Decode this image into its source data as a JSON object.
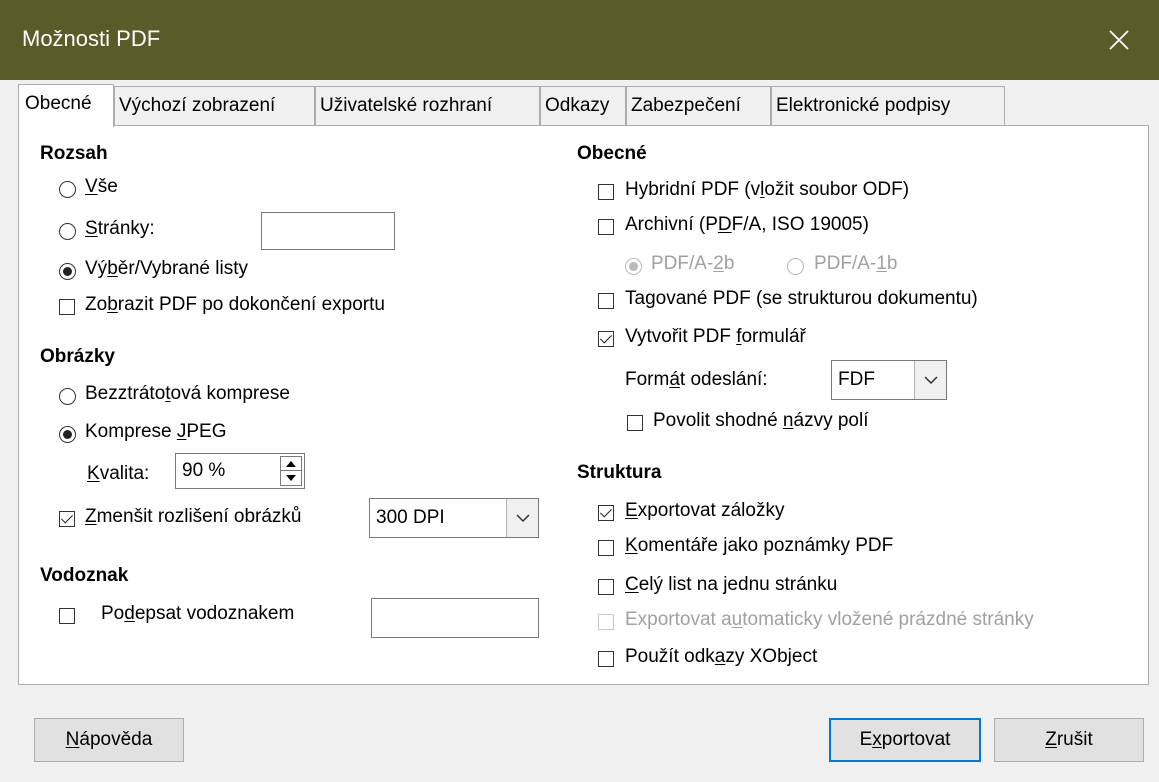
{
  "window": {
    "title": "Možnosti PDF",
    "close_icon": "close-icon"
  },
  "tabs": [
    {
      "label": "Obecné",
      "active": true
    },
    {
      "label": "Výchozí zobrazení"
    },
    {
      "label": "Uživatelské rozhraní"
    },
    {
      "label": "Odkazy"
    },
    {
      "label": "Zabezpečení"
    },
    {
      "label": "Elektronické podpisy"
    }
  ],
  "range": {
    "heading": "Rozsah",
    "all": {
      "pre": "",
      "mn": "V",
      "post": "še",
      "checked": false
    },
    "pages": {
      "pre": "",
      "mn": "S",
      "post": "tránky:",
      "checked": false,
      "value": ""
    },
    "selection": {
      "pre": "Vý",
      "mn": "b",
      "post": "ěr/Vybrané listy",
      "checked": true
    },
    "view_pdf": {
      "pre": "Zo",
      "mn": "b",
      "post": "razit PDF po dokončení exportu",
      "checked": false
    }
  },
  "images": {
    "heading": "Obrázky",
    "lossless": {
      "pre": "Bezztráto",
      "mn": "t",
      "post": "ová komprese",
      "checked": false
    },
    "jpeg": {
      "pre": "Komprese ",
      "mn": "J",
      "post": "PEG",
      "checked": true
    },
    "quality": {
      "pre": "",
      "mn": "K",
      "post": "valita:",
      "value": "90 %"
    },
    "reduce": {
      "pre": "",
      "mn": "Z",
      "post": "menšit rozlišení obrázků",
      "checked": true,
      "selected": "300 DPI"
    }
  },
  "watermark": {
    "heading": "Vodoznak",
    "sign": {
      "pre": "Po",
      "mn": "d",
      "post": "epsat vodoznakem",
      "checked": false,
      "value": ""
    }
  },
  "general": {
    "heading": "Obecné",
    "hybrid": {
      "pre": "Hybridní PDF (v",
      "mn": "l",
      "post": "ožit soubor ODF)",
      "checked": false
    },
    "archive": {
      "pre": "Archivní (P",
      "mn": "D",
      "post": "F/A, ISO 19005)",
      "checked": false
    },
    "pdfa2b": {
      "pre": "PDF/A-",
      "mn": "2",
      "post": "b",
      "checked": true
    },
    "pdfa1b": {
      "pre": "PDF/A-",
      "mn": "1",
      "post": "b",
      "checked": false
    },
    "tagged": {
      "pre": "Ta",
      "mn": "g",
      "post": "ované PDF (se strukturou dokumentu)",
      "checked": false
    },
    "form": {
      "pre": "Vytvořit PDF ",
      "mn": "f",
      "post": "ormulář",
      "checked": true
    },
    "submit": {
      "pre": "Form",
      "mn": "á",
      "post": "t odeslání:",
      "selected": "FDF"
    },
    "dup_names": {
      "pre": "Povolit shodné ",
      "mn": "n",
      "post": "ázvy polí",
      "checked": false
    }
  },
  "structure": {
    "heading": "Struktura",
    "bookmarks": {
      "pre": "",
      "mn": "E",
      "post": "xportovat záložky",
      "checked": true
    },
    "comments": {
      "pre": "",
      "mn": "K",
      "post": "omentáře jako poznámky PDF",
      "checked": false
    },
    "whole_sheet": {
      "pre": "",
      "mn": "C",
      "post": "elý list na jednu stránku",
      "checked": false
    },
    "blank_pages": {
      "pre": "Exportovat a",
      "mn": "u",
      "post": "tomaticky vložené prázdné stránky",
      "checked": false
    },
    "xobject": {
      "pre": "Použít odk",
      "mn": "a",
      "post": "zy XObject",
      "checked": false
    }
  },
  "buttons": {
    "help": {
      "pre": "",
      "mn": "N",
      "post": "ápověda"
    },
    "export": {
      "pre": "E",
      "mn": "x",
      "post": "portovat"
    },
    "cancel": {
      "pre": "",
      "mn": "Z",
      "post": "rušit"
    }
  }
}
